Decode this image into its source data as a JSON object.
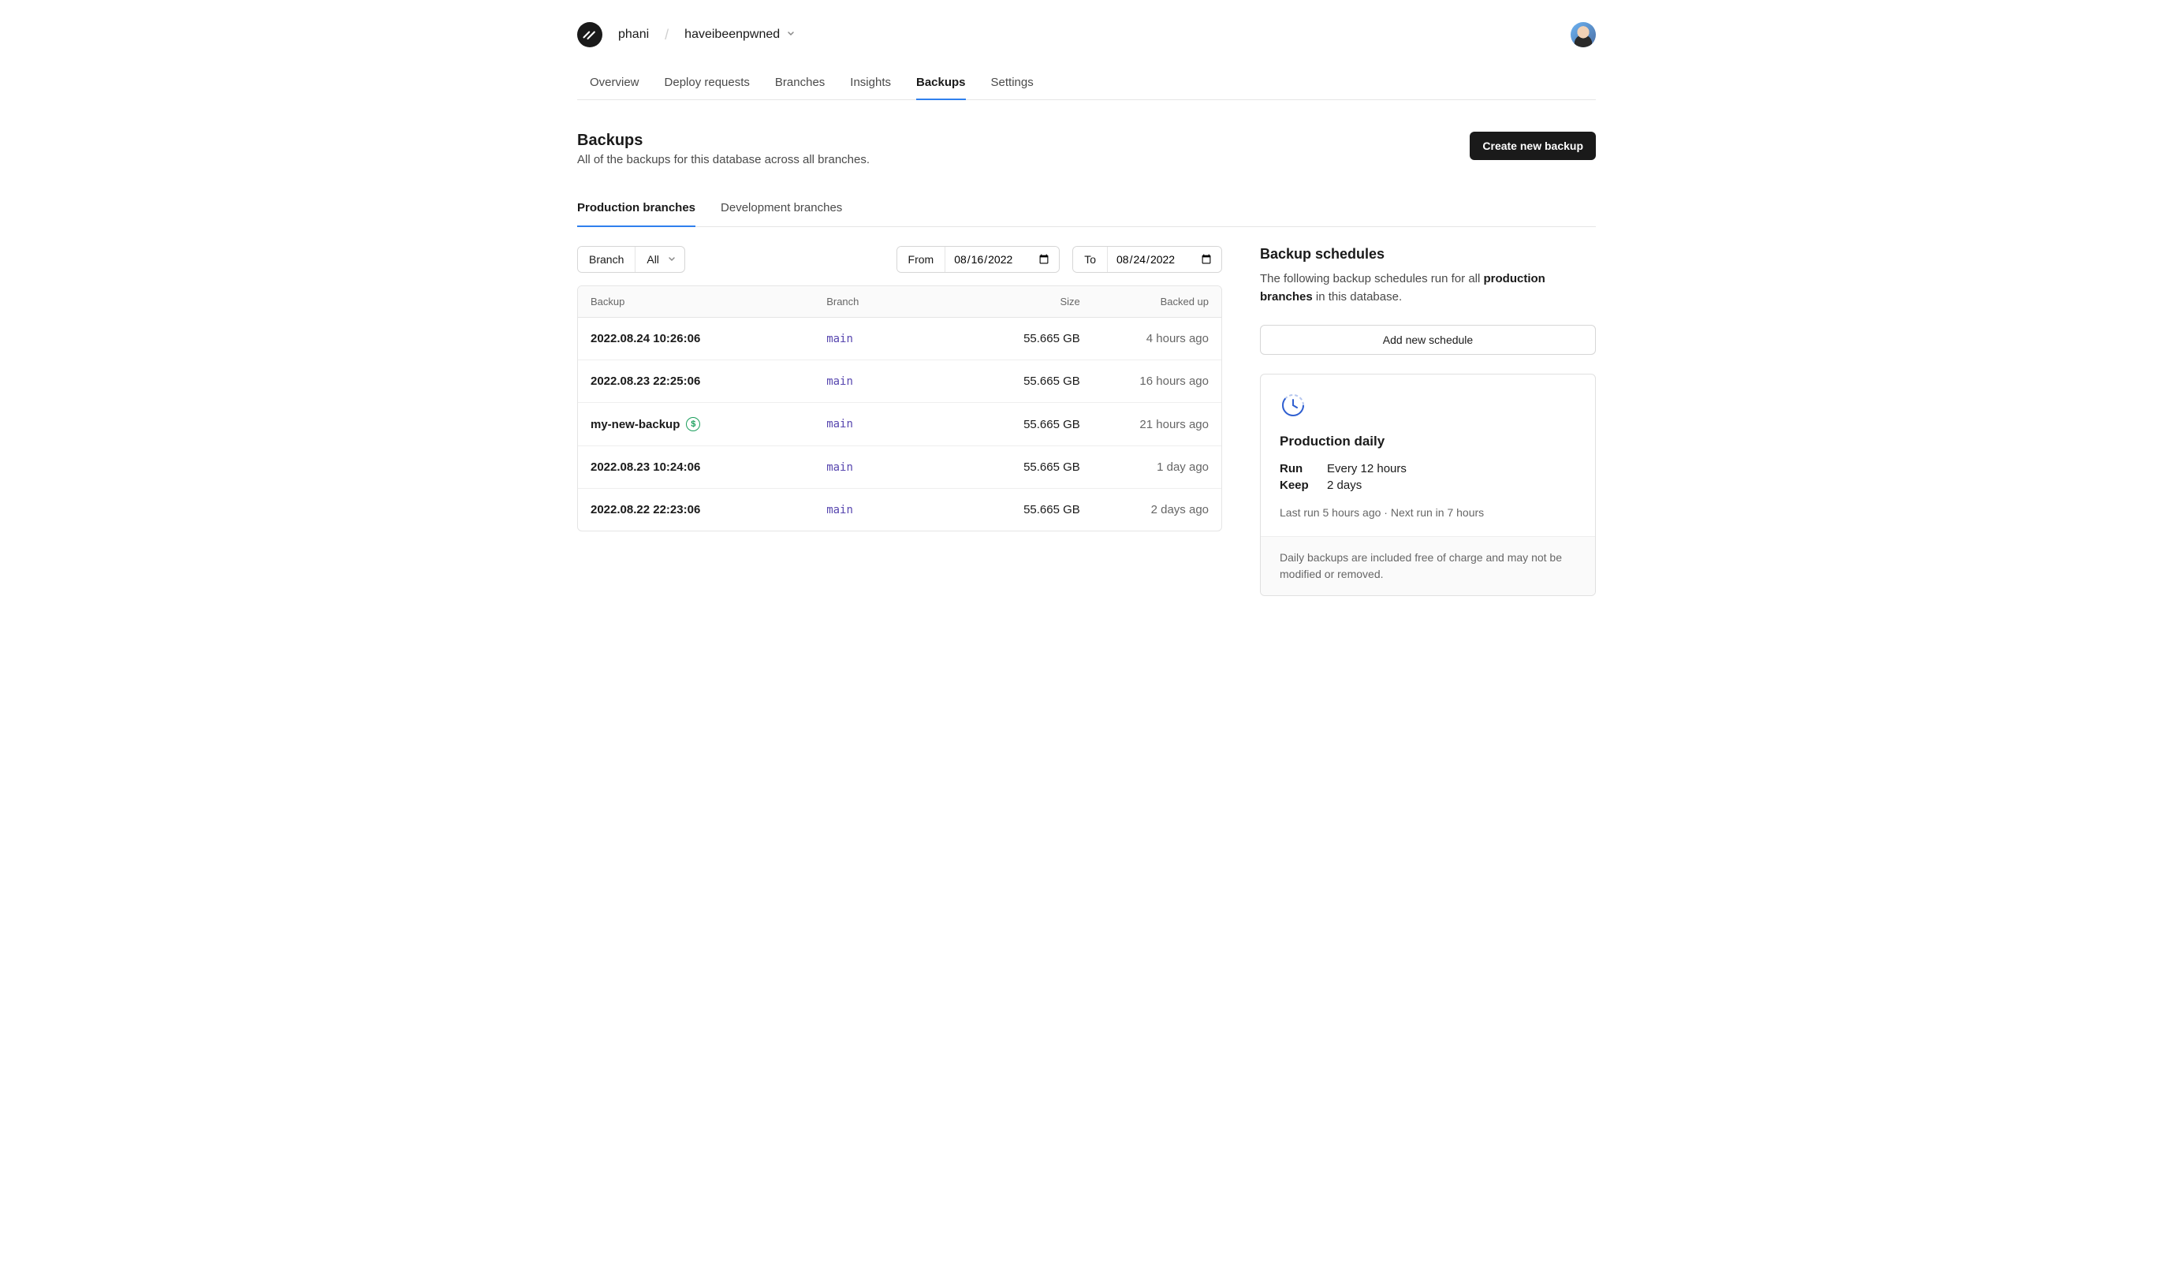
{
  "breadcrumb": {
    "org": "phani",
    "project": "haveibeenpwned"
  },
  "nav": {
    "items": [
      "Overview",
      "Deploy requests",
      "Branches",
      "Insights",
      "Backups",
      "Settings"
    ],
    "active_index": 4
  },
  "page": {
    "title": "Backups",
    "subtitle": "All of the backups for this database across all branches.",
    "create_button": "Create new backup"
  },
  "sub_tabs": {
    "items": [
      "Production branches",
      "Development branches"
    ],
    "active_index": 0
  },
  "filters": {
    "branch_label": "Branch",
    "branch_value": "All",
    "from_label": "From",
    "from_value": "2022-08-16",
    "to_label": "To",
    "to_value": "2022-08-24"
  },
  "table": {
    "headers": {
      "name": "Backup",
      "branch": "Branch",
      "size": "Size",
      "age": "Backed up"
    },
    "rows": [
      {
        "name": "2022.08.24 10:26:06",
        "branch": "main",
        "size": "55.665 GB",
        "age": "4 hours ago",
        "paid": false
      },
      {
        "name": "2022.08.23 22:25:06",
        "branch": "main",
        "size": "55.665 GB",
        "age": "16 hours ago",
        "paid": false
      },
      {
        "name": "my-new-backup",
        "branch": "main",
        "size": "55.665 GB",
        "age": "21 hours ago",
        "paid": true
      },
      {
        "name": "2022.08.23 10:24:06",
        "branch": "main",
        "size": "55.665 GB",
        "age": "1 day ago",
        "paid": false
      },
      {
        "name": "2022.08.22 22:23:06",
        "branch": "main",
        "size": "55.665 GB",
        "age": "2 days ago",
        "paid": false
      }
    ]
  },
  "schedules": {
    "title": "Backup schedules",
    "desc_pre": "The following backup schedules run for all ",
    "desc_strong": "production branches",
    "desc_post": " in this database.",
    "add_button": "Add new schedule",
    "card": {
      "title": "Production daily",
      "run_label": "Run",
      "run_value": "Every 12 hours",
      "keep_label": "Keep",
      "keep_value": "2 days",
      "meta": "Last run 5 hours ago  ·  Next run in 7 hours",
      "footer": "Daily backups are included free of charge and may not be modified or removed."
    }
  }
}
